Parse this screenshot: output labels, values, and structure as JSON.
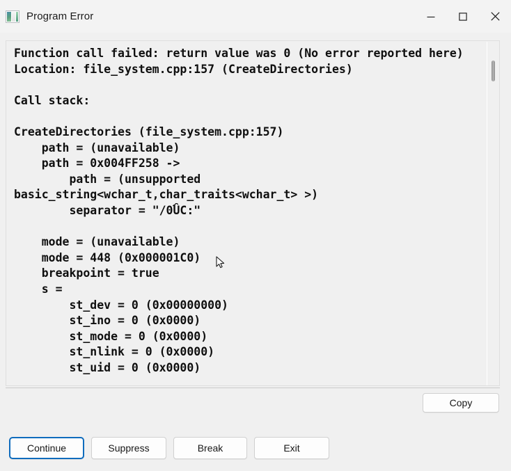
{
  "window": {
    "title": "Program Error",
    "icon": "image-app-icon"
  },
  "titlebar": {
    "minimize_label": "Minimize",
    "maximize_label": "Maximize",
    "close_label": "Close"
  },
  "output": {
    "text": "Function call failed: return value was 0 (No error reported here)\nLocation: file_system.cpp:157 (CreateDirectories)\n\nCall stack:\n\nCreateDirectories (file_system.cpp:157)\n    path = (unavailable)\n    path = 0x004FF258 ->\n        path = (unsupported basic_string<wchar_t,char_traits<wchar_t> >)\n        separator = \"/0ۘÛC:\"\n\n    mode = (unavailable)\n    mode = 448 (0x000001C0)\n    breakpoint = true\n    s =\n        st_dev = 0 (0x00000000)\n        st_ino = 0 (0x0000)\n        st_mode = 0 (0x0000)\n        st_nlink = 0 (0x0000)\n        st_uid = 0 (0x0000)",
    "scrollbar": "vertical-scrollbar"
  },
  "buttons": {
    "copy": "Copy",
    "continue": "Continue",
    "suppress": "Suppress",
    "break": "Break",
    "exit": "Exit"
  },
  "colors": {
    "focus_blue": "#0f6cbd",
    "window_bg": "#f0f0f0",
    "titlebar_bg": "#f3f3f3",
    "text_fg": "#0f0f0f"
  }
}
